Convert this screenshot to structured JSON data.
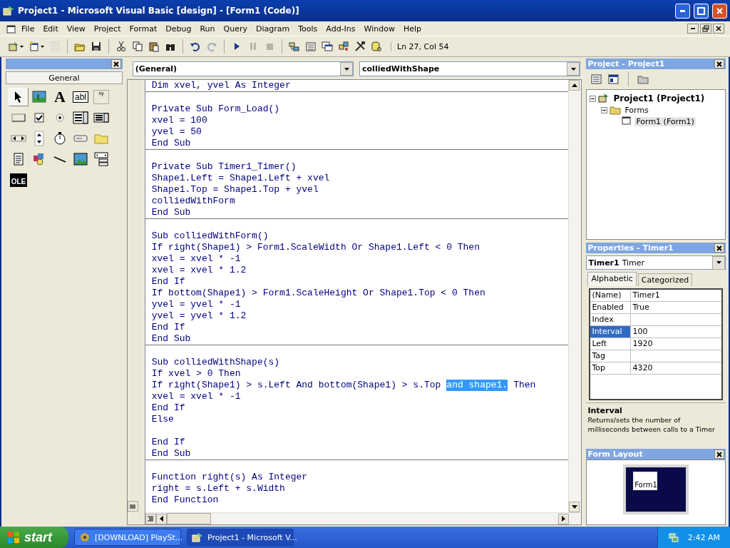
{
  "window": {
    "title": "Project1 - Microsoft Visual Basic [design] - [Form1 (Code)]"
  },
  "menu": [
    "File",
    "Edit",
    "View",
    "Project",
    "Format",
    "Debug",
    "Run",
    "Query",
    "Diagram",
    "Tools",
    "Add-Ins",
    "Window",
    "Help"
  ],
  "toolbar": {
    "buttons": [
      {
        "disabled": false
      },
      {
        "disabled": false
      },
      {
        "disabled": true
      },
      {
        "disabled": false
      },
      {
        "disabled": false
      },
      {
        "disabled": false
      },
      {
        "disabled": false
      },
      {
        "disabled": false
      },
      {
        "disabled": false
      },
      {
        "disabled": false
      },
      {
        "disabled": true
      },
      {
        "disabled": false
      },
      {
        "disabled": true
      },
      {
        "disabled": true
      },
      {
        "disabled": false
      },
      {
        "disabled": false
      },
      {
        "disabled": false
      },
      {
        "disabled": false
      },
      {
        "disabled": false
      },
      {
        "disabled": false
      }
    ],
    "position": "Ln 27, Col 54"
  },
  "toolbox": {
    "title": "General",
    "tools": [
      {
        "selected": true
      },
      {
        "selected": false
      },
      {
        "glyph": "A",
        "selected": false
      },
      {
        "glyph": "abl",
        "selected": false
      },
      {
        "glyph": "xy",
        "selected": false
      },
      {
        "selected": false
      },
      {
        "selected": false
      },
      {
        "selected": false
      },
      {
        "selected": false
      },
      {
        "selected": false
      },
      {
        "selected": false
      },
      {
        "selected": false
      },
      {
        "selected": false
      },
      {
        "selected": false
      },
      {
        "selected": false
      },
      {
        "selected": false
      },
      {
        "selected": false
      },
      {
        "selected": false
      },
      {
        "selected": false
      },
      {
        "selected": false
      },
      {
        "glyph": "OLE",
        "selected": false
      }
    ]
  },
  "code_window": {
    "object": "(General)",
    "procedure": "colliedWithShape",
    "sections": [
      {
        "lines": [
          {
            "kind": "code",
            "text": "Dim xvel, yvel As Integer"
          }
        ]
      },
      {
        "lines": [
          {
            "kind": "blank"
          },
          {
            "kind": "code",
            "text": "Private Sub Form_Load()"
          },
          {
            "kind": "code",
            "text": "xvel = 100"
          },
          {
            "kind": "code",
            "text": "yvel = 50"
          },
          {
            "kind": "code",
            "text": "End Sub"
          }
        ]
      },
      {
        "lines": [
          {
            "kind": "blank"
          },
          {
            "kind": "code",
            "text": "Private Sub Timer1_Timer()"
          },
          {
            "kind": "code",
            "text": "Shape1.Left = Shape1.Left + xvel"
          },
          {
            "kind": "code",
            "text": "Shape1.Top = Shape1.Top + yvel"
          },
          {
            "kind": "code",
            "text": "colliedWithForm"
          },
          {
            "kind": "code",
            "text": "End Sub"
          }
        ]
      },
      {
        "lines": [
          {
            "kind": "blank"
          },
          {
            "kind": "code",
            "text": "Sub colliedWithForm()"
          },
          {
            "kind": "code",
            "text": "If right(Shape1) > Form1.ScaleWidth Or Shape1.Left < 0 Then"
          },
          {
            "kind": "code",
            "text": "xvel = xvel * -1"
          },
          {
            "kind": "code",
            "text": "xvel = xvel * 1.2"
          },
          {
            "kind": "code",
            "text": "End If"
          },
          {
            "kind": "code",
            "text": "If bottom(Shape1) > Form1.ScaleHeight Or Shape1.Top < 0 Then"
          },
          {
            "kind": "code",
            "text": "yvel = yvel * -1"
          },
          {
            "kind": "code",
            "text": "yvel = yvel * 1.2"
          },
          {
            "kind": "code",
            "text": "End If"
          },
          {
            "kind": "code",
            "text": "End Sub"
          }
        ]
      },
      {
        "lines": [
          {
            "kind": "blank"
          },
          {
            "kind": "code",
            "text": "Sub colliedWithShape(s)"
          },
          {
            "kind": "code",
            "text": "If xvel > 0 Then"
          },
          {
            "kind": "parts",
            "parts": [
              {
                "text": "If right(Shape1) > s.Left And bottom(Shape1) > s.Top",
                "selected": false
              },
              {
                "text": "and shape1.",
                "selected": true
              },
              {
                "text": "Then",
                "selected": false
              }
            ]
          },
          {
            "kind": "code",
            "text": "xvel = xvel * -1"
          },
          {
            "kind": "code",
            "text": "End If"
          },
          {
            "kind": "code",
            "text": "Else"
          },
          {
            "kind": "blank"
          },
          {
            "kind": "code",
            "text": "End If"
          },
          {
            "kind": "code",
            "text": "End Sub"
          }
        ]
      },
      {
        "lines": [
          {
            "kind": "blank"
          },
          {
            "kind": "code",
            "text": "Function right(s) As Integer"
          },
          {
            "kind": "code",
            "text": "right = s.Left + s.Width"
          },
          {
            "kind": "code",
            "text": "End Function"
          }
        ]
      }
    ]
  },
  "project": {
    "title": "Project - Project1",
    "tree": [
      {
        "label": "Project1 (Project1)",
        "expanded": true,
        "selected": false,
        "children": [
          {
            "label": "Forms",
            "expanded": true,
            "selected": false,
            "children": [
              {
                "label": "Form1 (Form1)",
                "selected": true
              }
            ]
          }
        ]
      }
    ]
  },
  "properties": {
    "title": "Properties - Timer1",
    "object_name": "Timer1",
    "object_type": "Timer",
    "tabs": [
      {
        "label": "Alphabetic",
        "selected": true
      },
      {
        "label": "Categorized",
        "selected": false
      }
    ],
    "rows": [
      {
        "name": "(Name)",
        "value": "Timer1",
        "selected": false
      },
      {
        "name": "Enabled",
        "value": "True",
        "selected": false
      },
      {
        "name": "Index",
        "selected": false
      },
      {
        "name": "Interval",
        "value": "100",
        "selected": true
      },
      {
        "name": "Left",
        "value": "1920",
        "selected": false
      },
      {
        "name": "Tag",
        "selected": false
      },
      {
        "name": "Top",
        "value": "4320",
        "selected": false
      }
    ],
    "description_title": "Interval",
    "description": "Returns/sets the number of milliseconds between calls to a Timer"
  },
  "form_layout": {
    "title": "Form Layout",
    "form_label": "Form1"
  },
  "taskbar": {
    "start": "start",
    "tasks": [
      {
        "label": "[DOWNLOAD] PlaySt...",
        "selected": false
      },
      {
        "label": "Project1 - Microsoft V...",
        "selected": true
      }
    ],
    "clock": "2:42 AM"
  }
}
